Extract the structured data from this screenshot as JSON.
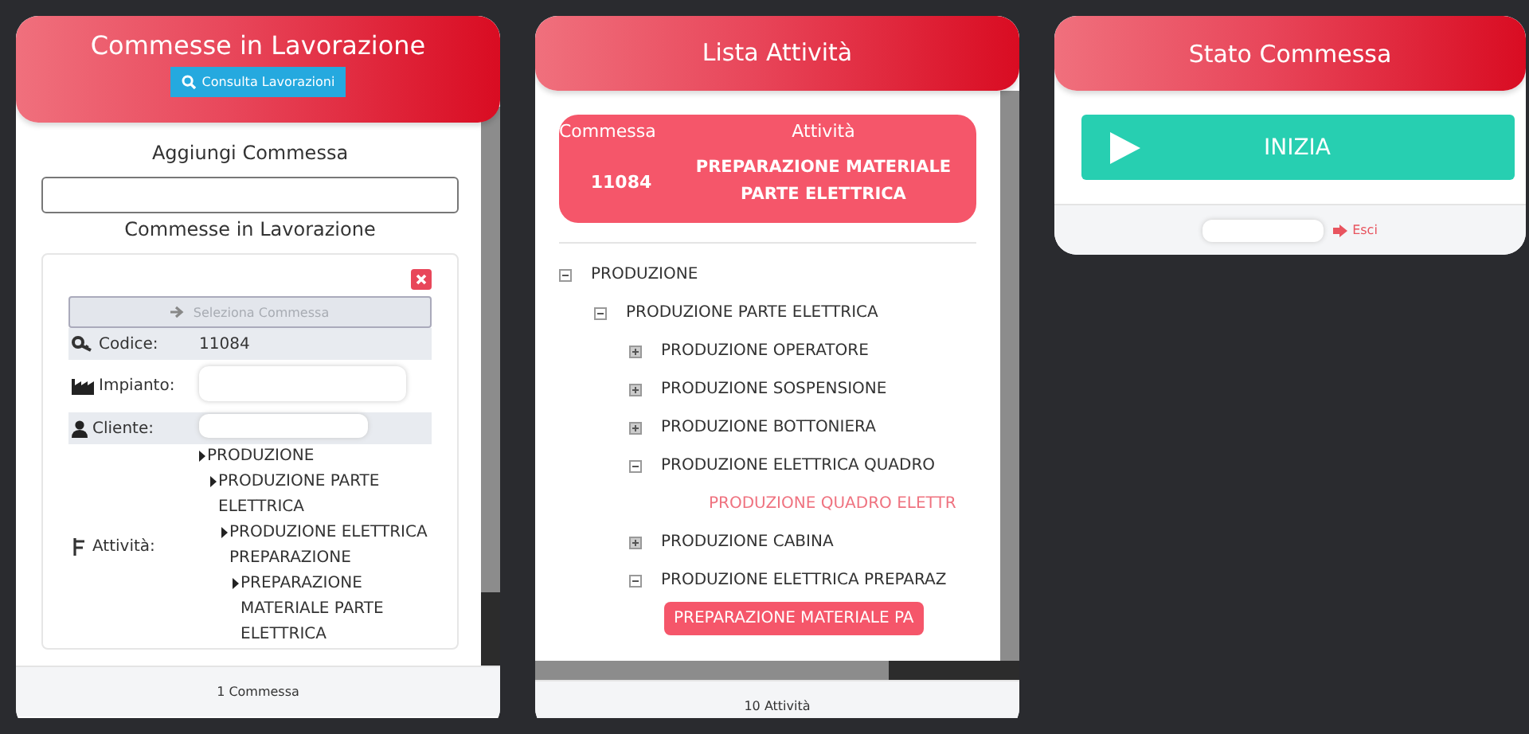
{
  "commesse_panel": {
    "title": "Commesse in Lavorazione",
    "header_button": "Consulta Lavorazioni",
    "add_label": "Aggiungi Commessa",
    "list_heading": "Commesse in Lavorazione",
    "select_button": {
      "label": "Seleziona Commessa",
      "disabled": true
    },
    "fields": [
      {
        "kind": "code",
        "label": "Codice:",
        "value": "11084"
      },
      {
        "kind": "plant",
        "label": "Impianto:",
        "redacted": true
      },
      {
        "kind": "client",
        "label": "Cliente:",
        "redacted": true
      },
      {
        "kind": "activity",
        "label": "Attività:",
        "tree": [
          {
            "text": "PRODUZIONE",
            "children": [
              {
                "text": "PRODUZIONE PARTE ELETTRICA",
                "children": [
                  {
                    "text": "PRODUZIONE ELETTRICA PREPARAZIONE",
                    "children": [
                      {
                        "text": "PREPARAZIONE MATERIALE PARTE ELETTRICA"
                      }
                    ]
                  }
                ]
              }
            ]
          }
        ]
      }
    ],
    "footer": "1 Commessa"
  },
  "attivita_panel": {
    "title": "Lista Attività",
    "summary": {
      "commessa_label": "Commessa",
      "attivita_label": "Attività",
      "commessa": "11084",
      "attivita": "PREPARAZIONE MATERIALE PARTE ELETTRICA"
    },
    "tree": [
      {
        "kind": "group",
        "text": "PRODUZIONE",
        "expanded": true,
        "selected": false,
        "children": [
          {
            "kind": "group",
            "text": "PRODUZIONE PARTE ELETTRICA",
            "expanded": true,
            "selected": false,
            "children": [
              {
                "kind": "group",
                "text": "PRODUZIONE OPERATORE",
                "expanded": false,
                "selected": false
              },
              {
                "kind": "group",
                "text": "PRODUZIONE SOSPENSIONE",
                "expanded": false,
                "selected": false
              },
              {
                "kind": "group",
                "text": "PRODUZIONE BOTTONIERA",
                "expanded": false,
                "selected": false
              },
              {
                "kind": "group",
                "text": "PRODUZIONE ELETTRICA QUADRO",
                "expanded": true,
                "selected": false,
                "children": [
                  {
                    "kind": "leaf",
                    "text": "PRODUZIONE QUADRO ELETTR",
                    "selected": false
                  }
                ]
              },
              {
                "kind": "group",
                "text": "PRODUZIONE CABINA",
                "expanded": false,
                "selected": false
              },
              {
                "kind": "group",
                "text": "PRODUZIONE ELETTRICA PREPARAZ",
                "expanded": true,
                "selected": false,
                "children": [
                  {
                    "kind": "leaf",
                    "text": "PREPARAZIONE MATERIALE PA",
                    "selected": true
                  }
                ]
              }
            ]
          }
        ]
      }
    ],
    "footer": "10 Attività"
  },
  "stato_panel": {
    "title": "Stato Commessa",
    "start_button": "INIZIA",
    "footer_redacted": true,
    "exit_link": "Esci"
  }
}
